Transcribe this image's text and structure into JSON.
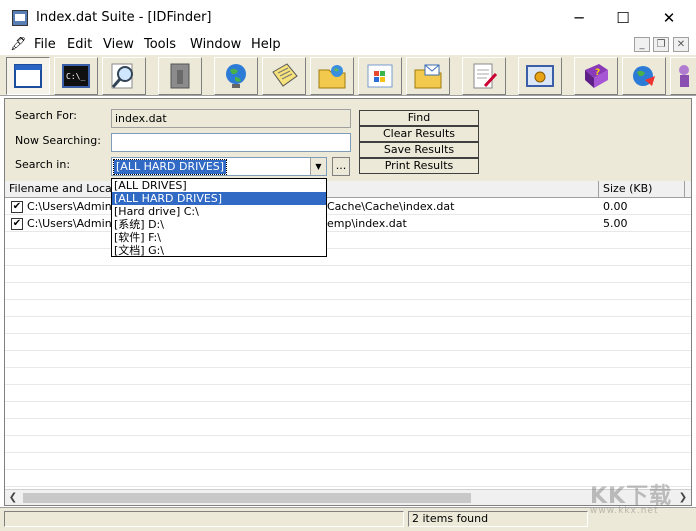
{
  "window": {
    "title": "Index.dat Suite - [IDFinder]",
    "minimize": "─",
    "maximize": "☐",
    "close": "✕"
  },
  "menu": [
    "File",
    "Edit",
    "View",
    "Tools",
    "Window",
    "Help"
  ],
  "mdi": {
    "minimize": "_",
    "restore": "❐",
    "close": "✕"
  },
  "toolbar_icons": [
    "window-icon",
    "console-icon",
    "magnifier-icon",
    "gray-icon",
    "globe-icon",
    "notepad-icon",
    "folder-globe-icon",
    "windows-app-icon",
    "folder-mail-icon",
    "document-pen-icon",
    "settings-window-icon",
    "help-book-icon",
    "globe-arrow-icon"
  ],
  "form": {
    "search_for_label": "Search For:",
    "search_for_value": "index.dat",
    "now_searching_label": "Now Searching:",
    "now_searching_value": "",
    "search_in_label": "Search in:",
    "search_in_value": "[ALL HARD DRIVES]",
    "browse_label": "..."
  },
  "buttons": {
    "find": "Find",
    "clear": "Clear Results",
    "save": "Save Results",
    "print": "Print Results"
  },
  "dropdown_options": [
    "[ALL DRIVES]",
    "[ALL HARD DRIVES]",
    "[Hard drive] C:\\",
    "[系统] D:\\",
    "[软件] F:\\",
    "[文档] G:\\"
  ],
  "dropdown_selected_index": 1,
  "table": {
    "columns": [
      "Filename and Location",
      "Size (KB)"
    ],
    "rows": [
      {
        "checked": true,
        "path_start": "C:\\Users\\Adminis",
        "path_end": "Cache\\Cache\\index.dat",
        "size": "0.00"
      },
      {
        "checked": true,
        "path_start": "C:\\Users\\Adminis",
        "path_end": "emp\\index.dat",
        "size": "5.00"
      }
    ]
  },
  "status": {
    "items_found": "2 items found"
  },
  "watermark": {
    "text": "KK下载",
    "sub": "www.kkx.net"
  }
}
